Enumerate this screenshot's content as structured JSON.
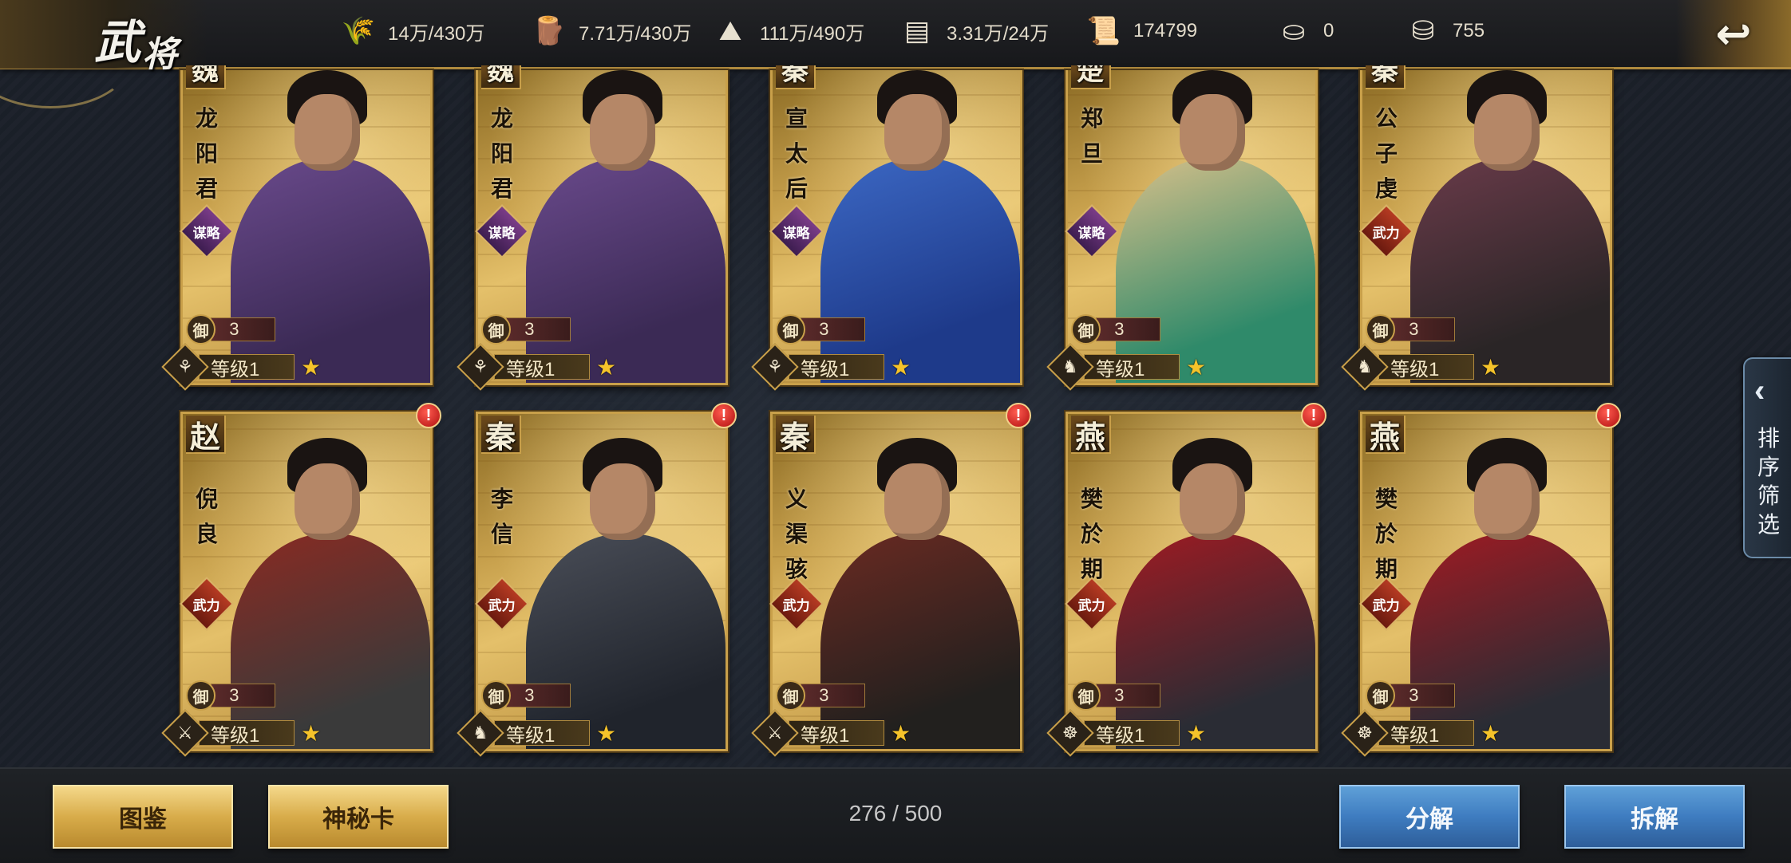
{
  "header": {
    "title_main": "武",
    "title_sub": "将",
    "back_icon": "return-arrow-icon",
    "resources": [
      {
        "icon": "grain-icon",
        "glyph": "🌾",
        "value": "14万/430万"
      },
      {
        "icon": "wood-icon",
        "glyph": "🪵",
        "value": "7.71万/430万"
      },
      {
        "icon": "stone-icon",
        "glyph": "⛰",
        "value": "111万/490万"
      },
      {
        "icon": "iron-icon",
        "glyph": "▤",
        "value": "3.31万/24万"
      },
      {
        "icon": "decree-icon",
        "glyph": "📜",
        "value": "174799"
      },
      {
        "icon": "gold-ingot-icon",
        "glyph": "⛀",
        "value": "0"
      },
      {
        "icon": "silver-ingot-icon",
        "glyph": "⛁",
        "value": "755"
      }
    ]
  },
  "cards": [
    {
      "faction": "魏",
      "name": [
        "龙",
        "阳",
        "君"
      ],
      "attr": "谋略",
      "attr_type": "mou",
      "defense_label": "御",
      "defense": "3",
      "level": "等级1",
      "role_icon": "archer-icon",
      "role_glyph": "⚘",
      "alert": false,
      "palette": [
        "#3b2a55",
        "#6a4a8c"
      ]
    },
    {
      "faction": "魏",
      "name": [
        "龙",
        "阳",
        "君"
      ],
      "attr": "谋略",
      "attr_type": "mou",
      "defense_label": "御",
      "defense": "3",
      "level": "等级1",
      "role_icon": "archer-icon",
      "role_glyph": "⚘",
      "alert": false,
      "palette": [
        "#3b2a55",
        "#6a4a8c"
      ]
    },
    {
      "faction": "秦",
      "name": [
        "宣",
        "太",
        "后"
      ],
      "attr": "谋略",
      "attr_type": "mou",
      "defense_label": "御",
      "defense": "3",
      "level": "等级1",
      "role_icon": "archer-icon",
      "role_glyph": "⚘",
      "alert": false,
      "palette": [
        "#1e3a8a",
        "#3c68c4"
      ]
    },
    {
      "faction": "楚",
      "name": [
        "郑",
        "旦"
      ],
      "attr": "谋略",
      "attr_type": "mou",
      "defense_label": "御",
      "defense": "3",
      "level": "等级1",
      "role_icon": "cavalry-icon",
      "role_glyph": "♞",
      "alert": false,
      "palette": [
        "#2f8a6a",
        "#d8c08a"
      ]
    },
    {
      "faction": "秦",
      "name": [
        "公",
        "子",
        "虔"
      ],
      "attr": "武力",
      "attr_type": "wu",
      "defense_label": "御",
      "defense": "3",
      "level": "等级1",
      "role_icon": "cavalry-icon",
      "role_glyph": "♞",
      "alert": false,
      "palette": [
        "#2a2526",
        "#6a3b4a"
      ]
    },
    {
      "faction": "赵",
      "name": [
        "倪",
        "良"
      ],
      "attr": "武力",
      "attr_type": "wu",
      "defense_label": "御",
      "defense": "3",
      "level": "等级1",
      "role_icon": "spear-icon",
      "role_glyph": "⚔",
      "alert": true,
      "palette": [
        "#3a3a3a",
        "#8a2a22"
      ]
    },
    {
      "faction": "秦",
      "name": [
        "李",
        "信"
      ],
      "attr": "武力",
      "attr_type": "wu",
      "defense_label": "御",
      "defense": "3",
      "level": "等级1",
      "role_icon": "cavalry-icon",
      "role_glyph": "♞",
      "alert": true,
      "palette": [
        "#20242c",
        "#4a4e58"
      ]
    },
    {
      "faction": "秦",
      "name": [
        "义",
        "渠",
        "骇"
      ],
      "attr": "武力",
      "attr_type": "wu",
      "defense_label": "御",
      "defense": "3",
      "level": "等级1",
      "role_icon": "spear-icon",
      "role_glyph": "⚔",
      "alert": true,
      "palette": [
        "#22201e",
        "#6a2a22"
      ]
    },
    {
      "faction": "燕",
      "name": [
        "樊",
        "於",
        "期"
      ],
      "attr": "武力",
      "attr_type": "wu",
      "defense_label": "御",
      "defense": "3",
      "level": "等级1",
      "role_icon": "chariot-icon",
      "role_glyph": "☸",
      "alert": true,
      "palette": [
        "#2a2c34",
        "#a01a22"
      ]
    },
    {
      "faction": "燕",
      "name": [
        "樊",
        "於",
        "期"
      ],
      "attr": "武力",
      "attr_type": "wu",
      "defense_label": "御",
      "defense": "3",
      "level": "等级1",
      "role_icon": "chariot-icon",
      "role_glyph": "☸",
      "alert": true,
      "palette": [
        "#2a2c34",
        "#a01a22"
      ]
    }
  ],
  "side_tab": {
    "label": "排序筛选",
    "icon": "chevron-left-icon"
  },
  "footer": {
    "catalog_btn": "图鉴",
    "mystery_btn": "神秘卡",
    "count": "276 / 500",
    "decompose_btn": "分解",
    "dismantle_btn": "拆解"
  }
}
